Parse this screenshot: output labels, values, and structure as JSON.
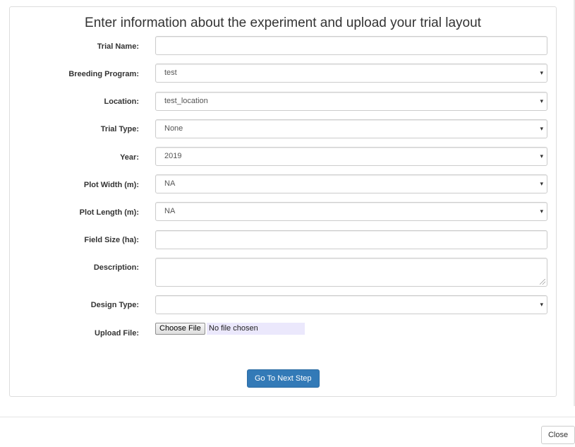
{
  "page_title": "Enter information about the experiment and upload your trial layout",
  "fields": {
    "trial_name": {
      "label": "Trial Name:",
      "value": ""
    },
    "breeding_program": {
      "label": "Breeding Program:",
      "value": "test"
    },
    "location": {
      "label": "Location:",
      "value": "test_location"
    },
    "trial_type": {
      "label": "Trial Type:",
      "value": "None"
    },
    "year": {
      "label": "Year:",
      "value": "2019"
    },
    "plot_width": {
      "label": "Plot Width (m):",
      "value": "NA"
    },
    "plot_length": {
      "label": "Plot Length (m):",
      "value": "NA"
    },
    "field_size": {
      "label": "Field Size (ha):",
      "value": ""
    },
    "description": {
      "label": "Description:",
      "value": ""
    },
    "design_type": {
      "label": "Design Type:",
      "value": ""
    },
    "upload_file": {
      "label": "Upload File:",
      "button_label": "Choose File",
      "status": "No file chosen"
    }
  },
  "buttons": {
    "next_step": "Go To Next Step",
    "close": "Close"
  },
  "icons": {
    "dropdown_caret": "▾"
  },
  "colors": {
    "primary": "#337ab7",
    "file_status_bg": "#ebe8fc"
  }
}
